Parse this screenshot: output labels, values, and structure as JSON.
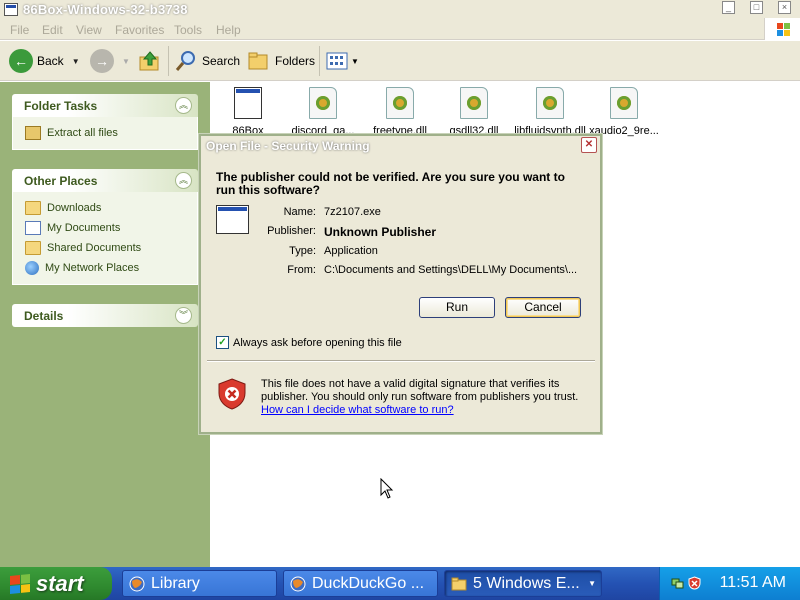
{
  "window": {
    "title": "86Box-Windows-32-b3738",
    "controls": [
      "minimize",
      "maximize",
      "close"
    ]
  },
  "menubar": {
    "items": [
      "File",
      "Edit",
      "View",
      "Favorites",
      "Tools",
      "Help"
    ]
  },
  "toolbar": {
    "back_label": "Back",
    "search_label": "Search",
    "folders_label": "Folders",
    "icons": [
      "back-arrow-icon",
      "forward-arrow-icon",
      "up-folder-icon",
      "search-icon",
      "folders-icon",
      "views-icon"
    ]
  },
  "sidebar": {
    "folder_tasks": {
      "title": "Folder Tasks",
      "items": [
        {
          "label": "Extract all files",
          "icon": "zip-icon"
        }
      ]
    },
    "other_places": {
      "title": "Other Places",
      "items": [
        {
          "label": "Downloads",
          "icon": "folder-icon"
        },
        {
          "label": "My Documents",
          "icon": "my-documents-icon"
        },
        {
          "label": "Shared Documents",
          "icon": "folder-icon"
        },
        {
          "label": "My Network Places",
          "icon": "network-icon"
        }
      ]
    },
    "details": {
      "title": "Details"
    }
  },
  "files": [
    {
      "name": "86Box",
      "icon": "exe-icon"
    },
    {
      "name": "discord_ga...",
      "icon": "dll-icon"
    },
    {
      "name": "freetype.dll",
      "icon": "dll-icon"
    },
    {
      "name": "gsdll32.dll",
      "icon": "dll-icon"
    },
    {
      "name": "libfluidsynth.dll",
      "icon": "dll-icon"
    },
    {
      "name": "xaudio2_9re...",
      "icon": "dll-icon"
    }
  ],
  "dialog": {
    "title": "Open File - Security Warning",
    "question": "The publisher could not be verified.  Are you sure you want to run this software?",
    "fields": {
      "name_label": "Name:",
      "name_value": "7z2107.exe",
      "publisher_label": "Publisher:",
      "publisher_value": "Unknown Publisher",
      "type_label": "Type:",
      "type_value": "Application",
      "from_label": "From:",
      "from_value": "C:\\Documents and Settings\\DELL\\My Documents\\..."
    },
    "run_label": "Run",
    "cancel_label": "Cancel",
    "always_ask_label": "Always ask before opening this file",
    "always_ask_checked": true,
    "warning_text": "This file does not have a valid digital signature that verifies its publisher.  You should only run software from publishers you trust.",
    "help_link": "How can I decide what software to run?"
  },
  "taskbar": {
    "start_label": "start",
    "tasks": [
      {
        "label": "Library",
        "icon": "firefox-icon",
        "active": false
      },
      {
        "label": "DuckDuckGo ...",
        "icon": "firefox-icon",
        "active": false
      },
      {
        "label": "5 Windows E...",
        "icon": "folder-icon",
        "active": true
      }
    ],
    "clock": "11:51 AM"
  },
  "colors": {
    "sidebar_bg": "#9ab379",
    "taskbar_blue": "#2452b3",
    "start_green": "#2f8a2f",
    "tray_blue": "#0e7fd1"
  }
}
